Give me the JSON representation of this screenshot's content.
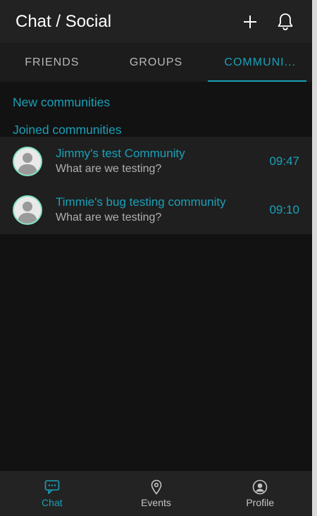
{
  "header": {
    "title": "Chat / Social",
    "add_icon": "plus-icon",
    "notifications_icon": "bell-icon"
  },
  "tabs": [
    {
      "label": "FRIENDS",
      "active": false
    },
    {
      "label": "GROUPS",
      "active": false
    },
    {
      "label": "COMMUNI...",
      "active": true
    }
  ],
  "sections": {
    "new_communities": "New communities",
    "joined_communities": "Joined communities"
  },
  "communities": [
    {
      "title": "Jimmy's test Community",
      "subtitle": "What are we testing?",
      "time": "09:47"
    },
    {
      "title": "Timmie's bug testing community",
      "subtitle": "What are we testing?",
      "time": "09:10"
    }
  ],
  "bottom_nav": [
    {
      "label": "Chat",
      "icon": "chat-bubble-icon",
      "active": true
    },
    {
      "label": "Events",
      "icon": "location-pin-icon",
      "active": false
    },
    {
      "label": "Profile",
      "icon": "user-circle-icon",
      "active": false
    }
  ],
  "colors": {
    "accent": "#1aa0b8",
    "background": "#121212",
    "header": "#222222",
    "avatar_ring": "#7fe0c4"
  }
}
